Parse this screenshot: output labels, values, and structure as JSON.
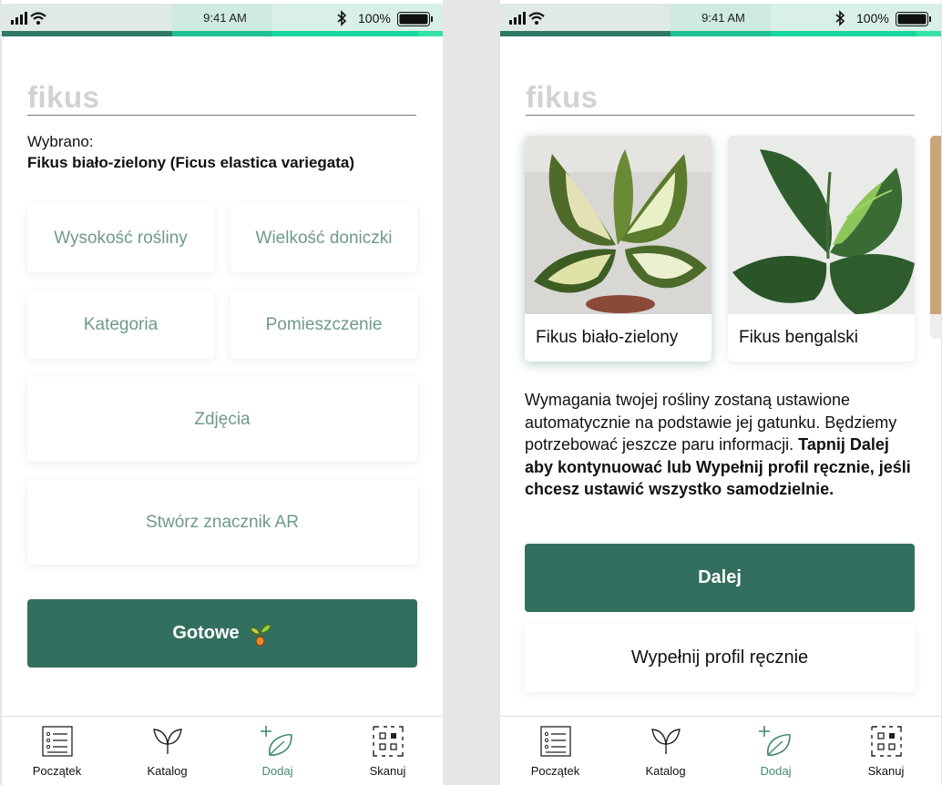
{
  "colors": {
    "primary": "#336f5e",
    "accent": "#3f8a6c",
    "field_text": "#6e9a88",
    "progress": [
      "#2f7a64",
      "#1fbf93",
      "#18d69d",
      "#36e0aa"
    ]
  },
  "status_bar": {
    "time": "9:41 AM",
    "battery": "100%"
  },
  "left": {
    "search": {
      "value": "fikus"
    },
    "selected_label": "Wybrano:",
    "selected_value": "Fikus biało-zielony (Ficus elastica variegata)",
    "fields": {
      "height": "Wysokość rośliny",
      "pot_size": "Wielkość doniczki",
      "category": "Kategoria",
      "room": "Pomieszczenie",
      "photos": "Zdjęcia",
      "ar_marker": "Stwórz znacznik AR"
    },
    "done_button": "Gotowe"
  },
  "right": {
    "search": {
      "value": "fikus"
    },
    "results": [
      {
        "name": "Fikus biało-zielony",
        "image": "variegated-ficus-photo"
      },
      {
        "name": "Fikus bengalski",
        "image": "bengal-ficus-photo"
      }
    ],
    "info_text": "Wymagania twojej rośliny zostaną ustawione automatycznie na podstawie jej gatunku. Będziemy potrzebować jeszcze paru informacji.",
    "info_bold": "Tapnij Dalej aby kontynuować lub Wypełnij profil ręcznie, jeśli chcesz ustawić wszystko samodzielnie.",
    "next_button": "Dalej",
    "manual_button": "Wypełnij profil ręcznie"
  },
  "tabbar": {
    "tabs": [
      {
        "label": "Początek",
        "icon": "list-icon"
      },
      {
        "label": "Katalog",
        "icon": "leaves-icon"
      },
      {
        "label": "Dodaj",
        "icon": "add-leaf-icon",
        "active": true
      },
      {
        "label": "Skanuj",
        "icon": "qr-scan-icon"
      }
    ]
  }
}
